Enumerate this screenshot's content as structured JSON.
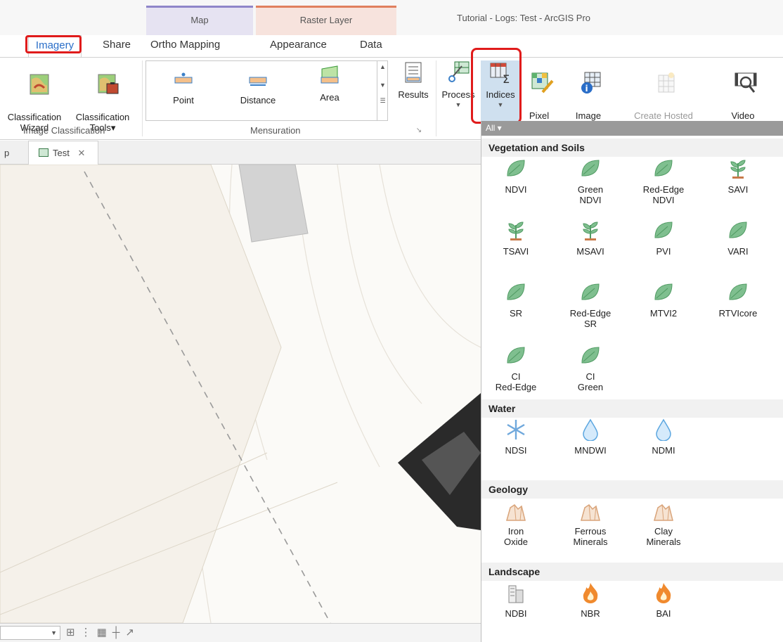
{
  "window": {
    "title": "Tutorial - Logs: Test - ArcGIS Pro",
    "contextual_tabs": {
      "map": "Map",
      "raster_layer": "Raster Layer"
    }
  },
  "tabs": [
    {
      "label": "Imagery",
      "active": true
    },
    {
      "label": "Share"
    },
    {
      "label": "Ortho Mapping"
    },
    {
      "label": "Appearance"
    },
    {
      "label": "Data"
    }
  ],
  "ribbon": {
    "image_classification": {
      "label": "Image Classification",
      "classification_wizard": "Classification\nWizard",
      "classification_tools": "Classification\nTools▾"
    },
    "mensuration": {
      "label": "Mensuration",
      "point": "Point",
      "distance": "Distance",
      "area": "Area"
    },
    "results": "Results",
    "process": "Process",
    "indices": "Indices",
    "pixel_editor": "Pixel\nEditor",
    "image_information": "Image\nInformation",
    "create_hosted_imagery": "Create Hosted\nImagery",
    "video_search": "Video\nSearch"
  },
  "map_view": {
    "tab_label": "Test",
    "left_fragment": "p"
  },
  "indices_panel": {
    "filter": "All ▾",
    "categories": [
      {
        "name": "Vegetation and Soils",
        "items": [
          "NDVI",
          "Green\nNDVI",
          "Red-Edge\nNDVI",
          "SAVI",
          "TSAVI",
          "MSAVI",
          "PVI",
          "VARI",
          "SR",
          "Red-Edge\nSR",
          "MTVI2",
          "RTVIcore",
          "CI\nRed-Edge",
          "CI\nGreen"
        ]
      },
      {
        "name": "Water",
        "items": [
          "NDSI",
          "MNDWI",
          "NDMI"
        ]
      },
      {
        "name": "Geology",
        "items": [
          "Iron\nOxide",
          "Ferrous\nMinerals",
          "Clay\nMinerals"
        ]
      },
      {
        "name": "Landscape",
        "items": [
          "NDBI",
          "NBR",
          "BAI"
        ]
      }
    ]
  },
  "colors": {
    "accent": "#2a6ec8",
    "highlight_outline": "#e01b1b",
    "indices_selected": "#cfe0ef",
    "leaf_green": "#7fbf8f",
    "water_blue": "#5ba6e0",
    "fire_orange": "#f08a2e",
    "rock_tan": "#d9a47a"
  }
}
